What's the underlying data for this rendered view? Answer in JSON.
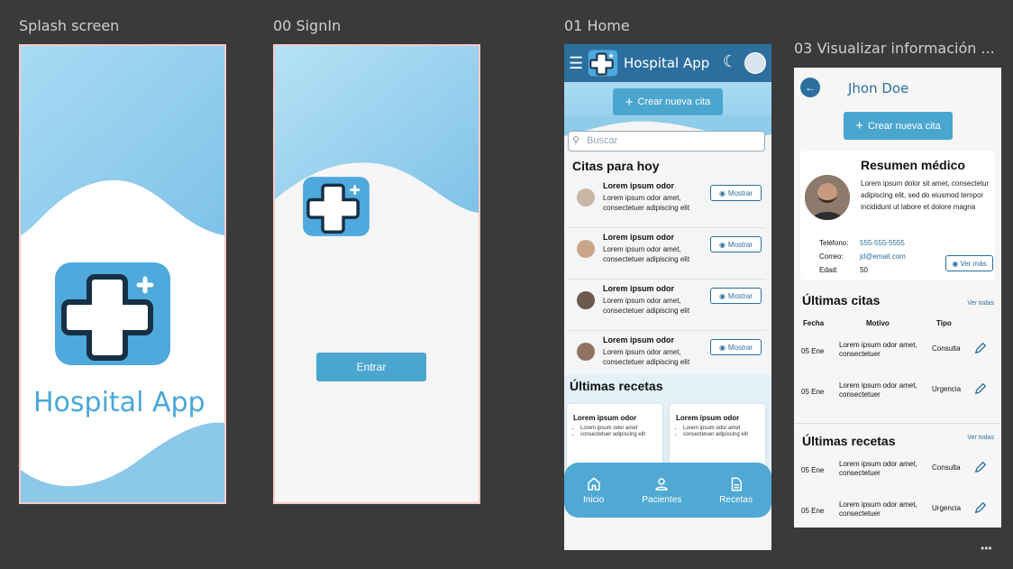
{
  "frames": {
    "splash_label": "Splash screen",
    "signin_label": "00 SignIn",
    "home_label": "01 Home",
    "visual_label": "03 Visualizar información ..."
  },
  "splash": {
    "app_title": "Hospital App"
  },
  "signin": {
    "enter_label": "Entrar"
  },
  "home": {
    "app_title": "Hospital App",
    "new_appointment": "Crear nueva cita",
    "search_placeholder": "Buscar",
    "today_title": "Citas para hoy",
    "appointments": [
      {
        "name": "Lorem ipsum odor",
        "desc": "Lorem ipsum odor amet, consectetuer adipiscing elit",
        "action": "Mostrar"
      },
      {
        "name": "Lorem ipsum odor",
        "desc": "Lorem ipsum odor amet, consectetuer adipiscing elit",
        "action": "Mostrar"
      },
      {
        "name": "Lorem ipsum odor",
        "desc": "Lorem ipsum odor amet, consectetuer adipiscing elit",
        "action": "Mostrar"
      },
      {
        "name": "Lorem ipsum odor",
        "desc": "Lorem ipsum odor amet, consectetuer adipiscing elit",
        "action": "Mostrar"
      }
    ],
    "recipes_title": "Últimas recetas",
    "recipes": [
      {
        "title": "Lorem ipsum odor",
        "items": [
          "Lorem ipsum odor amet",
          "consectetuer adipiscing elit"
        ]
      },
      {
        "title": "Lorem ipsum odor",
        "items": [
          "Lorem ipsum odor amet",
          "consectetuer adipiscing elit"
        ]
      }
    ],
    "nav": {
      "home": "Inicio",
      "patients": "Pacientes",
      "recipes": "Recetas"
    }
  },
  "visual": {
    "patient_name": "Jhon Doe",
    "new_appointment": "Crear nueva cita",
    "summary_title": "Resumen médico",
    "summary_text": "Lorem ipsum dolor sit amet, consectetur adipiscing elit, sed do eiusmod tempor incididunt ut labore et dolore magna",
    "phone_label": "Teléfono:",
    "phone": "555-555-5555",
    "email_label": "Correo:",
    "email": "jd@email.com",
    "age_label": "Edad:",
    "age": "50",
    "more_label": "Ver más",
    "last_appts_title": "Últimas citas",
    "see_all": "Ver todas",
    "headers": {
      "date": "Fecha",
      "reason": "Motivo",
      "type": "Tipo"
    },
    "last_appts": [
      {
        "date": "05 Ene",
        "reason": "Lorem ipsum odor amet, consectetuer",
        "type": "Consulta"
      },
      {
        "date": "05 Ene",
        "reason": "Lorem ipsum odor amet, consectetuer",
        "type": "Urgencia"
      }
    ],
    "last_recipes_title": "Últimas recetas",
    "last_recipes": [
      {
        "date": "05 Ene",
        "reason": "Lorem ipsum odor amet, consectetuer",
        "type": "Consulta"
      },
      {
        "date": "05 Ene",
        "reason": "Lorem ipsum odor amet, consectetuer",
        "type": "Urgencia"
      }
    ]
  },
  "colors": {
    "primary": "#2c6f9e",
    "accent": "#4aa6cf",
    "wave": "#8fcbea"
  },
  "icons": [
    "menu-icon",
    "logo-icon",
    "moon-icon",
    "search-icon",
    "eye-icon",
    "home-icon",
    "user-icon",
    "document-icon",
    "back-arrow-icon",
    "pencil-icon",
    "plus-icon"
  ]
}
